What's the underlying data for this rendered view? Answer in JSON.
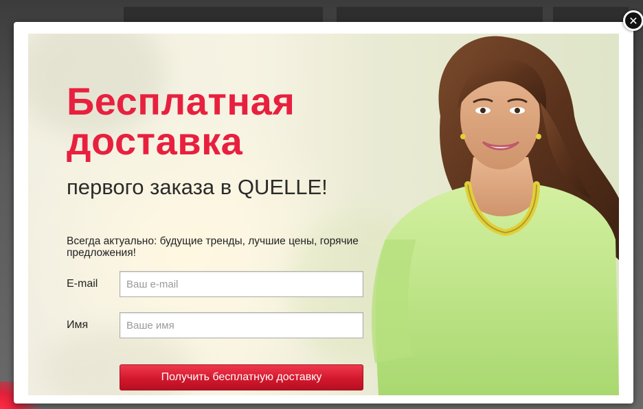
{
  "promo": {
    "headline_line1": "Бесплатная",
    "headline_line2": "доставка",
    "subheadline": "первого заказа в QUELLE!",
    "tagline": "Всегда актуально: будущие тренды, лучшие цены, горячие предложения!"
  },
  "form": {
    "email_label": "E-mail",
    "email_placeholder": "Ваш e-mail",
    "email_value": "",
    "name_label": "Имя",
    "name_placeholder": "Ваше имя",
    "name_value": "",
    "submit_label": "Получить бесплатную доставку"
  },
  "close": {
    "icon": "close-icon",
    "symbol": "✕"
  },
  "image": {
    "icon": "woman-photo"
  },
  "colors": {
    "accent_red": "#e8203f",
    "button_red": "#d3182d",
    "blouse_green": "#bfe58a",
    "necklace_gold": "#e2cf3a"
  }
}
